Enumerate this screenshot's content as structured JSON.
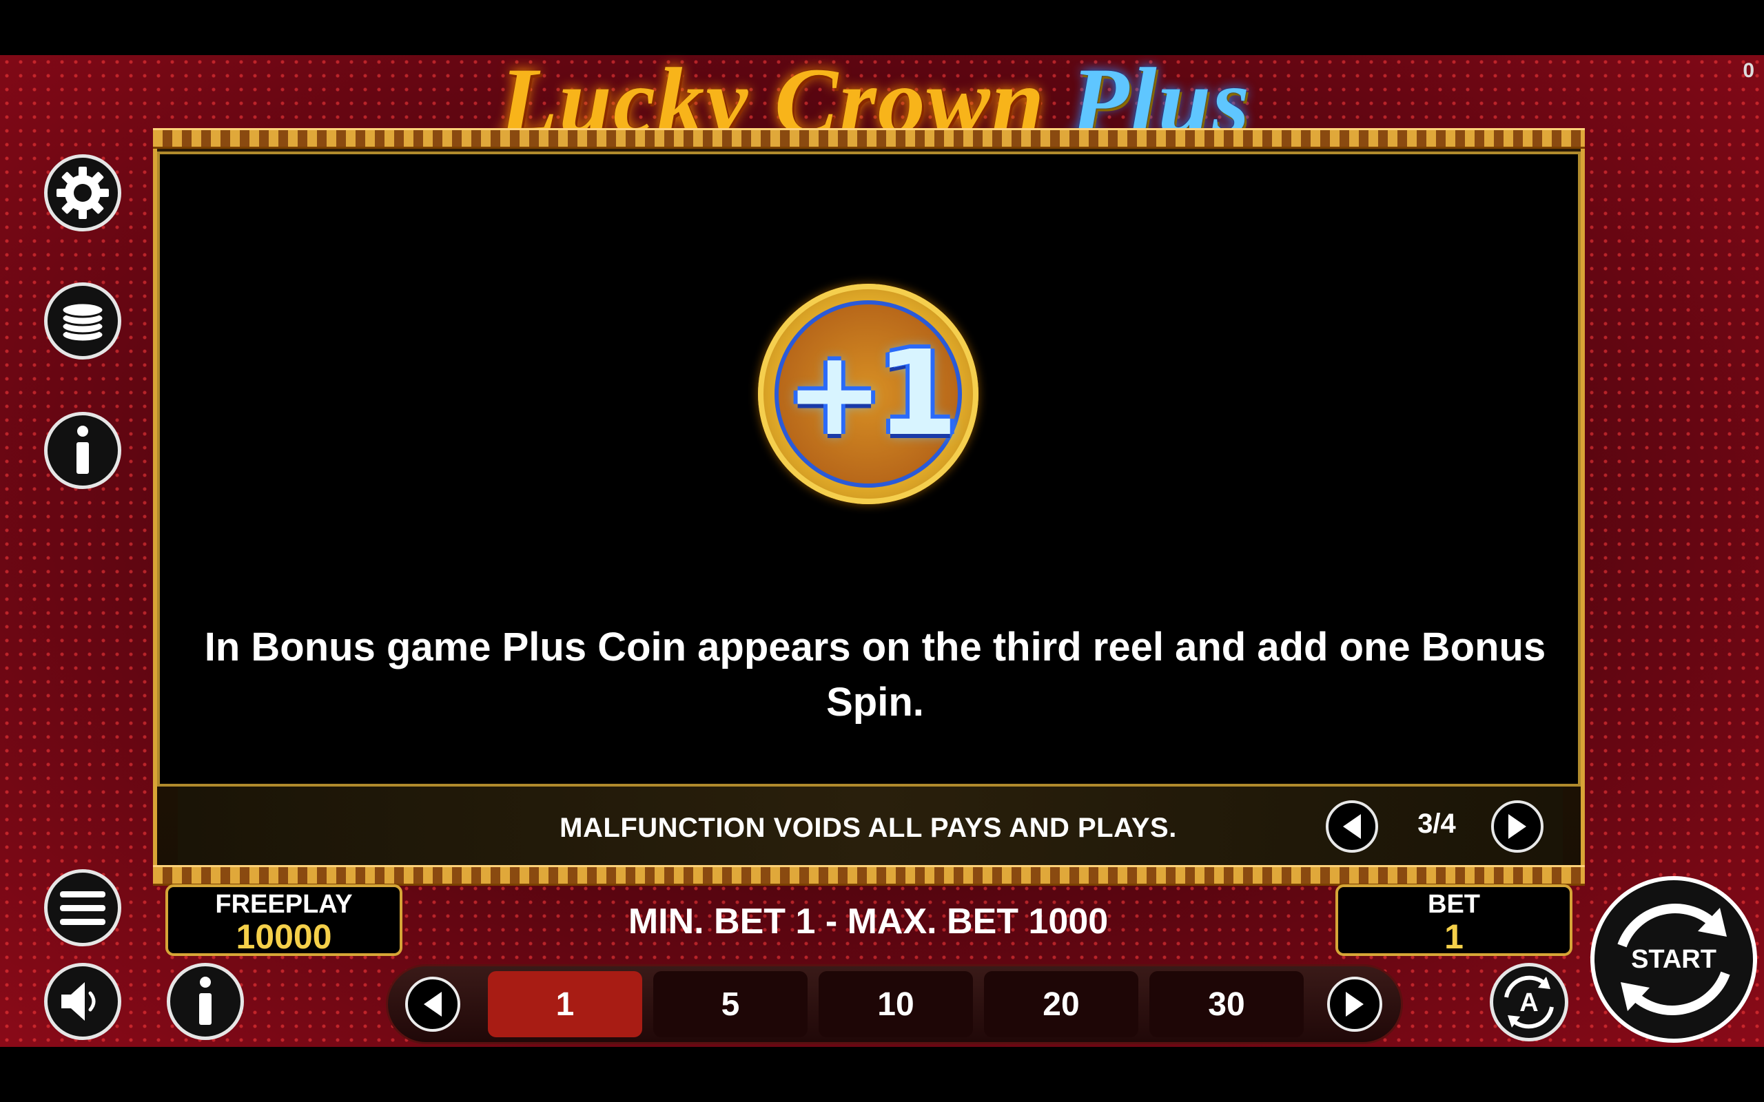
{
  "game": {
    "title_part1": "Lucky Crown ",
    "title_part2": "Plus",
    "corner_counter": "0"
  },
  "info_panel": {
    "coin_label": "+1",
    "description": "In Bonus game Plus Coin appears on the third reel and add one Bonus Spin.",
    "notice": "MALFUNCTION VOIDS ALL PAYS AND PLAYS.",
    "page_indicator": "3/4"
  },
  "sidebar": {
    "icons": [
      "gear-icon",
      "coins-icon",
      "info-icon"
    ]
  },
  "bottom_bar": {
    "freeplay_label": "FREEPLAY",
    "freeplay_value": "10000",
    "limits": "MIN. BET 1 - MAX. BET 1000",
    "bet_label": "BET",
    "bet_value": "1",
    "bet_options": [
      "1",
      "5",
      "10",
      "20",
      "30"
    ],
    "selected_bet": "1",
    "start_label": "START"
  },
  "colors": {
    "accent_gold": "#d6a637",
    "selected_chip": "#a81c14",
    "background_red": "#8a0a18"
  }
}
